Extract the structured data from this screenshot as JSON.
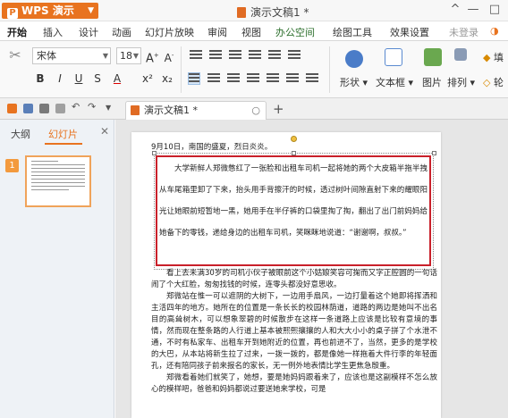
{
  "titlebar": {
    "app_name": "WPS 演示",
    "doc_title": "演示文稿1 *"
  },
  "menu": [
    "开始",
    "插入",
    "设计",
    "动画",
    "幻灯片放映",
    "审阅",
    "视图",
    "办公空间",
    "绘图工具",
    "效果设置",
    "未登录"
  ],
  "ribbon": {
    "font_name": "宋体",
    "font_size": "18",
    "shape_label": "形状",
    "textbox_label": "文本框",
    "picture_label": "图片",
    "arrange_label": "排列",
    "fill_label": "填",
    "outline_label": "轮"
  },
  "tabs": {
    "doc_tab": "演示文稿1 *"
  },
  "leftpanel": {
    "tab_outline": "大纲",
    "tab_slides": "幻灯片",
    "slide_number": "1"
  },
  "slide": {
    "line1": "9月10日，南国的盛夏，烈日炎炎。",
    "highlight_paragraph": "大学新鲜人郑微憋红了一张脸和出租车司机一起将她的两个大皮箱半拖半拽从车尾箱里卸了下来，抬头用手背擦汗的时候，透过树叶间隙直射下来的耀眼阳光让她眼前短暂地一黑，她用手在半仔裤的口袋里掏了掏，翻出了出门前妈妈给她备下的零钱，递给身边的出租车司机，笑眯眯地说道：“谢谢啊，叔叔。”",
    "para2": "看上去未满30岁的司机小伙子被眼前这个小姑娘笑容可掬而又字正腔圆的一句话闹了个大红脸，匆匆找钱的时候，连零头都没好意思收。",
    "para3": "郑微站在惟一可以遮阴的大树下，一边用手扇风，一边打量着这个她即将挥洒和主活四年的地方。她所在的位置是一条长长的校园林荫道，道路的两边是她叫不出名目的高耸树木，可以想象翠碧的时候散步在这样一条道路上应该是比较有意境的事情，然而现在整条路的人行道上基本被熙熙攘攘的人和大大小小的桌子拼了个水泄不通，不时有私家车、出租车开到她附近的位置，再也前进不了，当然，更多的是学校的大巴，从本站将新生拉了过来，一拨一拨的，都是像她一样拖着大件行李的年轻面孔，还有陪同孩子前来报名的家长，无一例外地表情比学生更焦急殷重。",
    "para4": "郑微看着她们就笑了，她想，要是她妈妈跟着来了，应该也是这副模样不怎么放心的模样吧，爸爸和妈妈都说过要送她来学校，可是"
  },
  "colors": {
    "accent": "#e8731f",
    "highlight_border": "#c9202a"
  }
}
